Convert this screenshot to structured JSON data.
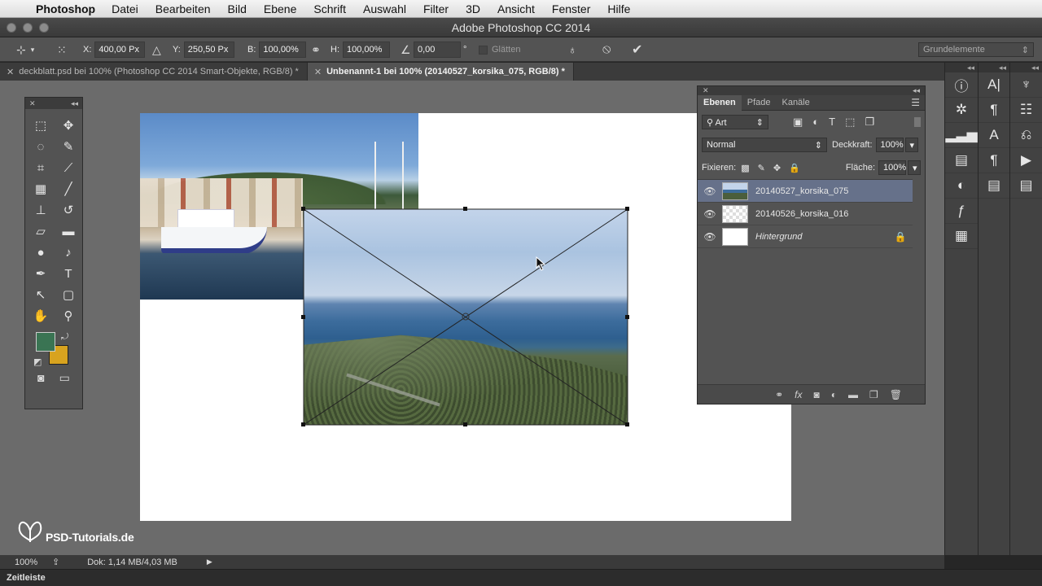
{
  "menubar": {
    "app_name": "Photoshop",
    "items": [
      "Datei",
      "Bearbeiten",
      "Bild",
      "Ebene",
      "Schrift",
      "Auswahl",
      "Filter",
      "3D",
      "Ansicht",
      "Fenster",
      "Hilfe"
    ]
  },
  "window": {
    "title": "Adobe Photoshop CC 2014"
  },
  "options_bar": {
    "x_label": "X:",
    "x_value": "400,00 Px",
    "y_label": "Y:",
    "y_value": "250,50 Px",
    "b_label": "B:",
    "b_value": "100,00%",
    "h_label": "H:",
    "h_value": "100,00%",
    "angle_value": "0,00",
    "angle_unit": "°",
    "smooth_label": "Glätten",
    "workspace_preset": "Grundelemente"
  },
  "doc_tabs": [
    {
      "label": "deckblatt.psd bei 100% (Photoshop CC 2014  Smart-Objekte, RGB/8) *",
      "active": false
    },
    {
      "label": "Unbenannt-1 bei 100% (20140527_korsika_075, RGB/8) *",
      "active": true
    }
  ],
  "watermark": {
    "text": "PSD-Tutorials.de"
  },
  "colors": {
    "foreground": "#3a7453",
    "background": "#d8a31f",
    "selection": "#66718a"
  },
  "layers_panel": {
    "tabs": [
      "Ebenen",
      "Pfade",
      "Kanäle"
    ],
    "filter_kind": "Art",
    "blend_mode": "Normal",
    "opacity_label": "Deckkraft:",
    "opacity_value": "100%",
    "lock_label": "Fixieren:",
    "fill_label": "Fläche:",
    "fill_value": "100%",
    "layers": [
      {
        "name": "20140527_korsika_075",
        "selected": true,
        "italic": false,
        "locked": false
      },
      {
        "name": "20140526_korsika_016",
        "selected": false,
        "italic": false,
        "locked": false
      },
      {
        "name": "Hintergrund",
        "selected": false,
        "italic": true,
        "locked": true
      }
    ]
  },
  "status_bar": {
    "zoom": "100%",
    "doc_info": "Dok: 1,14 MB/4,03 MB"
  },
  "timeline": {
    "label": "Zeitleiste"
  },
  "icons": {
    "tools": [
      "marquee-icon",
      "move-icon",
      "lasso-icon",
      "quick-select-icon",
      "crop-icon",
      "eyedropper-icon",
      "healing-icon",
      "brush-icon",
      "stamp-icon",
      "history-brush-icon",
      "eraser-icon",
      "gradient-icon",
      "blur-icon",
      "dodge-icon",
      "pen-icon",
      "type-icon",
      "path-select-icon",
      "shape-icon",
      "hand-icon",
      "zoom-icon"
    ],
    "dock1": [
      "info-icon",
      "navigator-icon",
      "histogram-icon",
      "layer-comps-icon",
      "adjustments-icon",
      "styles-icon",
      "swatches-grid-icon"
    ],
    "dock2": [
      "character-icon",
      "paragraph-icon",
      "character-styles-icon",
      "paragraph-styles-icon",
      "glyph-icon"
    ],
    "dock3": [
      "brush-preset-icon",
      "properties-icon",
      "clone-source-icon",
      "timeline-play-icon",
      "notes-icon"
    ]
  }
}
